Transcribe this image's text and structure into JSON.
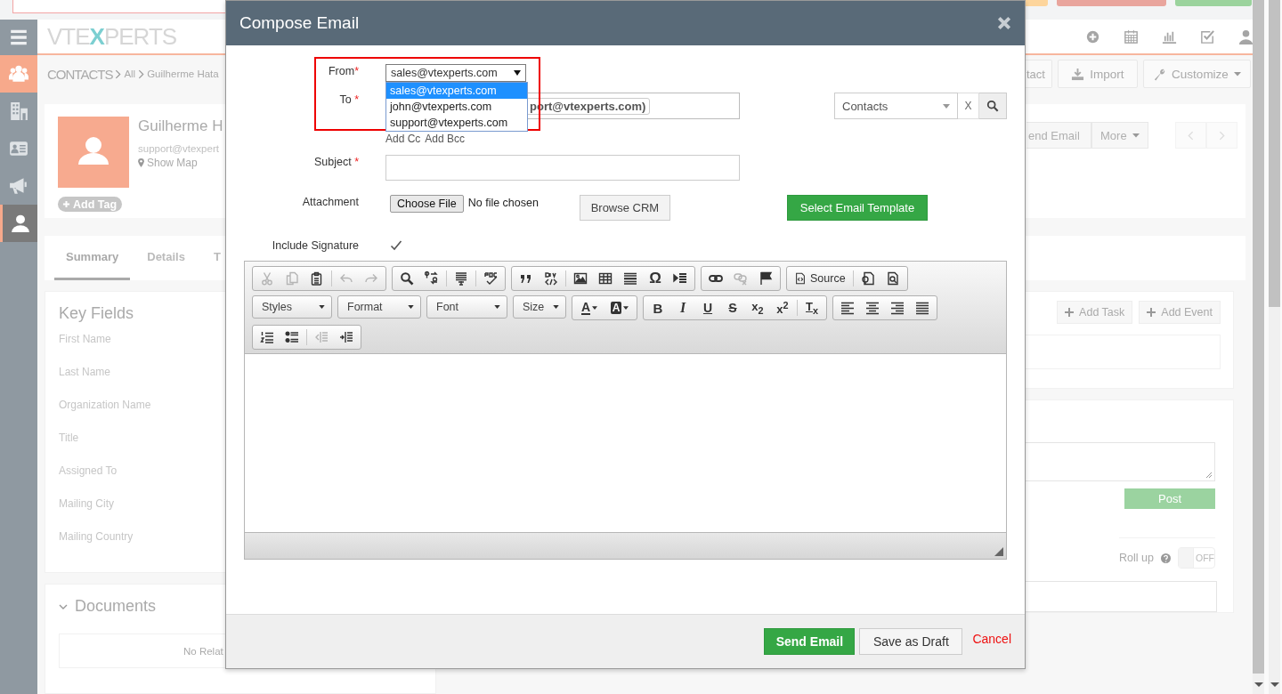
{
  "top_bar": {
    "buttons": [
      {
        "color": "#fdd59c"
      },
      {
        "color": "#e9a59d"
      },
      {
        "color": "#9bd39d"
      }
    ]
  },
  "sidebar": {
    "items": [
      {
        "kind": "menu",
        "selected": false,
        "accent": false
      },
      {
        "kind": "contacts",
        "selected": false,
        "accent": true
      },
      {
        "kind": "building",
        "selected": false,
        "accent": false
      },
      {
        "kind": "card",
        "selected": false,
        "accent": false
      },
      {
        "kind": "megaphone",
        "selected": false,
        "accent": false
      },
      {
        "kind": "person",
        "selected": true,
        "accent": false
      }
    ]
  },
  "header": {
    "logo": [
      {
        "text": "VTE",
        "accent": false
      },
      {
        "text": "X",
        "accent": true
      },
      {
        "text": "PERTS",
        "accent": false
      }
    ],
    "icons": [
      {
        "kind": "add"
      },
      {
        "kind": "calendar"
      },
      {
        "kind": "chart"
      },
      {
        "kind": "task"
      },
      {
        "kind": "user"
      }
    ]
  },
  "breadcrumb": {
    "module": "CONTACTS",
    "items": [
      "All",
      "Guilherme Hata"
    ]
  },
  "page_actions": [
    {
      "kind": "plain",
      "label": "tact"
    },
    {
      "kind": "import",
      "label": "Import"
    },
    {
      "kind": "customize",
      "label": "Customize"
    }
  ],
  "contact": {
    "name": "Guilherme H",
    "email": "support@vtexpert",
    "map_link": "Show Map",
    "tag_button": "Add Tag"
  },
  "record_actions": [
    {
      "kind": "plain",
      "label": "end Email"
    },
    {
      "kind": "menu",
      "label": "More"
    }
  ],
  "tabs": [
    {
      "label": "Summary",
      "selected": true
    },
    {
      "label": "Details",
      "selected": false
    },
    {
      "label": "T",
      "selected": false
    }
  ],
  "key_fields": {
    "title": "Key Fields",
    "fields": [
      "First Name",
      "Last Name",
      "Organization Name",
      "Title",
      "Assigned To",
      "Mailing City",
      "Mailing Country"
    ]
  },
  "documents": {
    "title": "Documents",
    "empty": "No Relat"
  },
  "activities": {
    "buttons": [
      "Add Task",
      "Add Event"
    ]
  },
  "comments": {
    "post_button": "Post",
    "post_disabled": true,
    "rollup_label": "Roll up",
    "rollup_toggle": {
      "on": false,
      "label": "OFF"
    }
  },
  "modal": {
    "title": "Compose Email",
    "from": {
      "label": "From",
      "mark": "*",
      "value": "sales@vtexperts.com",
      "expanded": true,
      "options": [
        {
          "label": "sales@vtexperts.com",
          "selected": true
        },
        {
          "label": "john@vtexperts.com",
          "selected": false
        },
        {
          "label": "support@vtexperts.com",
          "selected": false
        }
      ]
    },
    "to": {
      "label": "To",
      "mark": "*",
      "chip": "port@vtexperts.com)",
      "module": "Contacts",
      "clear": "X"
    },
    "cc_links": [
      "Add Cc",
      "Add Bcc"
    ],
    "subject": {
      "label": "Subject",
      "mark": "*"
    },
    "attachment": {
      "label": "Attachment",
      "choose": "Choose File",
      "status": "No file chosen",
      "browse": "Browse CRM",
      "template": "Select Email Template"
    },
    "signature": {
      "label": "Include Signature",
      "checked": true
    },
    "toolbar": [
      [
        [
          {
            "kind": "cut",
            "disabled": true
          },
          {
            "kind": "copy",
            "disabled": true
          },
          {
            "kind": "paste",
            "disabled": false
          },
          {
            "kind": "separator"
          },
          {
            "kind": "undo",
            "disabled": true
          },
          {
            "kind": "redo",
            "disabled": true
          }
        ],
        [
          {
            "kind": "find",
            "disabled": false
          },
          {
            "kind": "replace",
            "disabled": false
          },
          {
            "kind": "separator"
          },
          {
            "kind": "selectall",
            "disabled": false
          },
          {
            "kind": "separator"
          },
          {
            "kind": "spellcheck",
            "disabled": false
          }
        ],
        [
          {
            "kind": "blockquote",
            "disabled": false
          },
          {
            "kind": "div",
            "disabled": false
          },
          {
            "kind": "separator"
          },
          {
            "kind": "image",
            "disabled": false
          },
          {
            "kind": "table",
            "disabled": false
          },
          {
            "kind": "hr",
            "disabled": false
          },
          {
            "kind": "symbol",
            "text": "Ω",
            "disabled": false
          },
          {
            "kind": "pagebreak",
            "disabled": false
          }
        ],
        [
          {
            "kind": "link",
            "disabled": false
          },
          {
            "kind": "unlink",
            "disabled": true
          },
          {
            "kind": "anchor",
            "disabled": false
          }
        ],
        [
          {
            "kind": "source",
            "text": "Source",
            "disabled": false
          },
          {
            "kind": "separator"
          },
          {
            "kind": "templates",
            "disabled": false
          },
          {
            "kind": "preview",
            "disabled": false
          }
        ]
      ],
      [
        [
          {
            "kind": "combo",
            "text": "Styles"
          }
        ],
        [
          {
            "kind": "combo",
            "text": "Format"
          }
        ],
        [
          {
            "kind": "combo",
            "text": "Font"
          }
        ],
        [
          {
            "kind": "combo",
            "text": "Size"
          }
        ],
        [
          {
            "kind": "textcolor",
            "text": "A",
            "disabled": false
          },
          {
            "kind": "bgcolor",
            "text": "A",
            "disabled": false
          }
        ],
        [
          {
            "kind": "bold",
            "text": "B",
            "disabled": false
          },
          {
            "kind": "italic",
            "text": "I",
            "disabled": false
          },
          {
            "kind": "underline",
            "text": "U",
            "disabled": false
          },
          {
            "kind": "strike",
            "text": "S",
            "disabled": false
          },
          {
            "kind": "script",
            "text": "x$_{2}$",
            "disabled": false
          },
          {
            "kind": "script",
            "text": "x$^{2}$",
            "disabled": false
          },
          {
            "kind": "separator"
          },
          {
            "kind": "removeformat",
            "text": "T$_{x}$",
            "disabled": false
          }
        ],
        [
          {
            "kind": "alignleft",
            "disabled": false
          },
          {
            "kind": "aligncenter",
            "disabled": false
          },
          {
            "kind": "alignright",
            "disabled": false
          },
          {
            "kind": "justify",
            "disabled": false
          }
        ]
      ],
      [
        [
          {
            "kind": "numlist",
            "disabled": false
          },
          {
            "kind": "bullist",
            "disabled": false
          },
          {
            "kind": "separator"
          },
          {
            "kind": "outdent",
            "disabled": true
          },
          {
            "kind": "indent",
            "disabled": false
          }
        ]
      ]
    ],
    "footer": {
      "send": "Send Email",
      "draft": "Save as Draft",
      "cancel": "Cancel"
    }
  }
}
